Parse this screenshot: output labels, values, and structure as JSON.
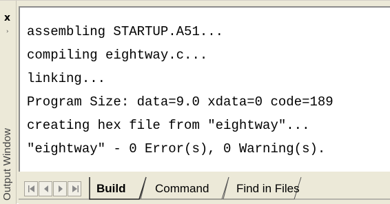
{
  "window": {
    "title": "Output Window",
    "close_glyph": "x",
    "pin_glyph": "›"
  },
  "output": {
    "lines": [
      "assembling STARTUP.A51...",
      "compiling eightway.c...",
      "linking...",
      "Program Size: data=9.0 xdata=0 code=189",
      "creating hex file from \"eightway\"...",
      "\"eightway\" - 0 Error(s), 0 Warning(s)."
    ]
  },
  "tabs": [
    {
      "label": "Build",
      "active": true
    },
    {
      "label": "Command",
      "active": false
    },
    {
      "label": "Find in Files",
      "active": false
    }
  ],
  "nav_icons": [
    "first-icon",
    "previous-icon",
    "next-icon",
    "last-icon"
  ]
}
